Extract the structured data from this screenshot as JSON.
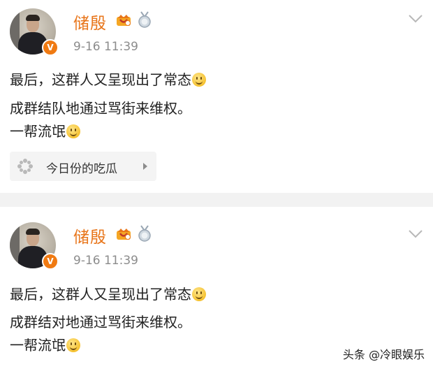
{
  "posts": [
    {
      "author": "储殷",
      "time": "9-16 11:39",
      "lines": [
        "最后，这群人又呈现出了常态",
        "成群结队地通过骂街来维权。",
        "一帮流氓"
      ],
      "topic": "今日份的吃瓜",
      "verified_badge": "V"
    },
    {
      "author": "储殷",
      "time": "9-16 11:39",
      "lines": [
        "最后，这群人又呈现出了常态",
        "成群结对地通过骂街来维权。",
        "一帮流氓"
      ],
      "verified_badge": "V"
    }
  ],
  "watermark": "头条 @冷眼娱乐",
  "icons": {
    "name_badge": "crown-vip-icon",
    "medal": "medal-icon",
    "menu": "chevron-down-icon",
    "emoji": "smile-emoji-icon",
    "topic": "flower-icon",
    "topic_arrow": "caret-right-icon"
  },
  "colors": {
    "author_name": "#e8751a",
    "badge": "#f07a12",
    "timestamp": "#8c8c8c",
    "divider": "#f2f2f2"
  }
}
